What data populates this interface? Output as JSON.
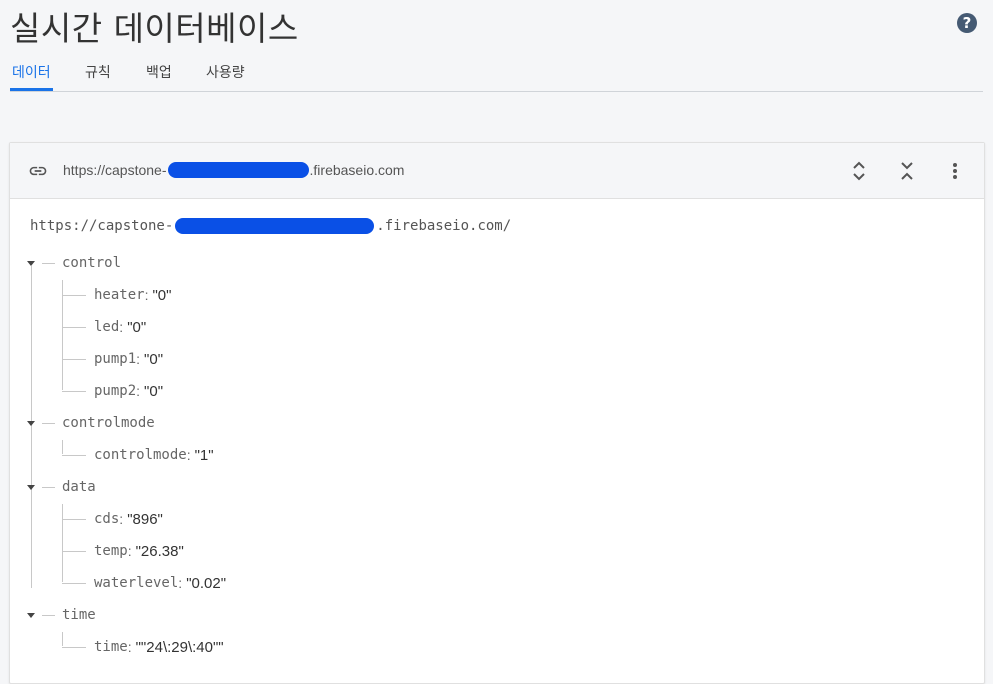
{
  "header": {
    "title": "실시간 데이터베이스",
    "help_icon": "question-circle-icon",
    "tabs": [
      {
        "label": "데이터",
        "active": true
      },
      {
        "label": "규칙",
        "active": false
      },
      {
        "label": "백업",
        "active": false
      },
      {
        "label": "사용량",
        "active": false
      }
    ]
  },
  "toolbar": {
    "url_prefix": "https://capstone-",
    "url_suffix": ".firebaseio.com",
    "icons": [
      "link-icon",
      "expand-icon",
      "collapse-icon",
      "more-vert-icon"
    ]
  },
  "tree": {
    "root_prefix": "https://capstone-",
    "root_suffix": ".firebaseio.com/",
    "nodes": [
      {
        "key": "control",
        "children": [
          {
            "key": "heater",
            "value": "\"0\""
          },
          {
            "key": "led",
            "value": "\"0\""
          },
          {
            "key": "pump1",
            "value": "\"0\""
          },
          {
            "key": "pump2",
            "value": "\"0\""
          }
        ]
      },
      {
        "key": "controlmode",
        "children": [
          {
            "key": "controlmode",
            "value": "\"1\""
          }
        ]
      },
      {
        "key": "data",
        "children": [
          {
            "key": "cds",
            "value": "\"896\""
          },
          {
            "key": "temp",
            "value": "\"26.38\""
          },
          {
            "key": "waterlevel",
            "value": "\"0.02\""
          }
        ]
      },
      {
        "key": "time",
        "children": [
          {
            "key": "time",
            "value": "\"\"24\\:29\\:40\"\""
          }
        ]
      }
    ]
  },
  "colors": {
    "accent": "#1a73e8",
    "redaction": "#0a50e6"
  }
}
